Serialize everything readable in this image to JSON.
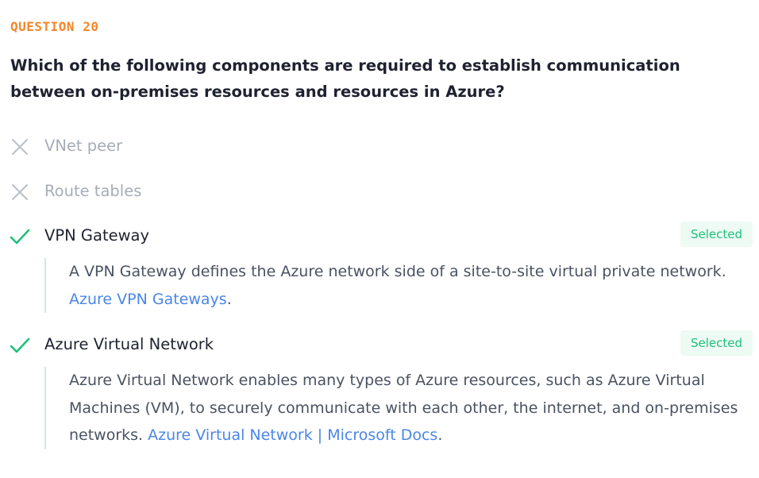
{
  "question": {
    "label": "QUESTION 20",
    "text": "Which of the following components are required to establish communication between on-premises resources and resources in Azure?"
  },
  "options": [
    {
      "label": "VNet peer",
      "state": "incorrect",
      "icon": "x-icon"
    },
    {
      "label": "Route tables",
      "state": "incorrect",
      "icon": "x-icon"
    },
    {
      "label": "VPN Gateway",
      "state": "correct",
      "icon": "check-icon",
      "badge": "Selected",
      "explanation": "A VPN Gateway defines the Azure network side of a site-to-site virtual private network. ",
      "link": "Azure VPN Gateways",
      "after_link": "."
    },
    {
      "label": "Azure Virtual Network",
      "state": "correct",
      "icon": "check-icon",
      "badge": "Selected",
      "explanation": "Azure Virtual Network enables many types of Azure resources, such as Azure Virtual Machines (VM), to securely communicate with each other, the internet, and on-premises networks. ",
      "link": "Azure Virtual Network | Microsoft Docs",
      "after_link": "."
    }
  ],
  "colors": {
    "accent_orange": "#f5862a",
    "correct_green": "#1fc07b",
    "incorrect_gray": "#a6adb6",
    "link_blue": "#4a86e8"
  }
}
